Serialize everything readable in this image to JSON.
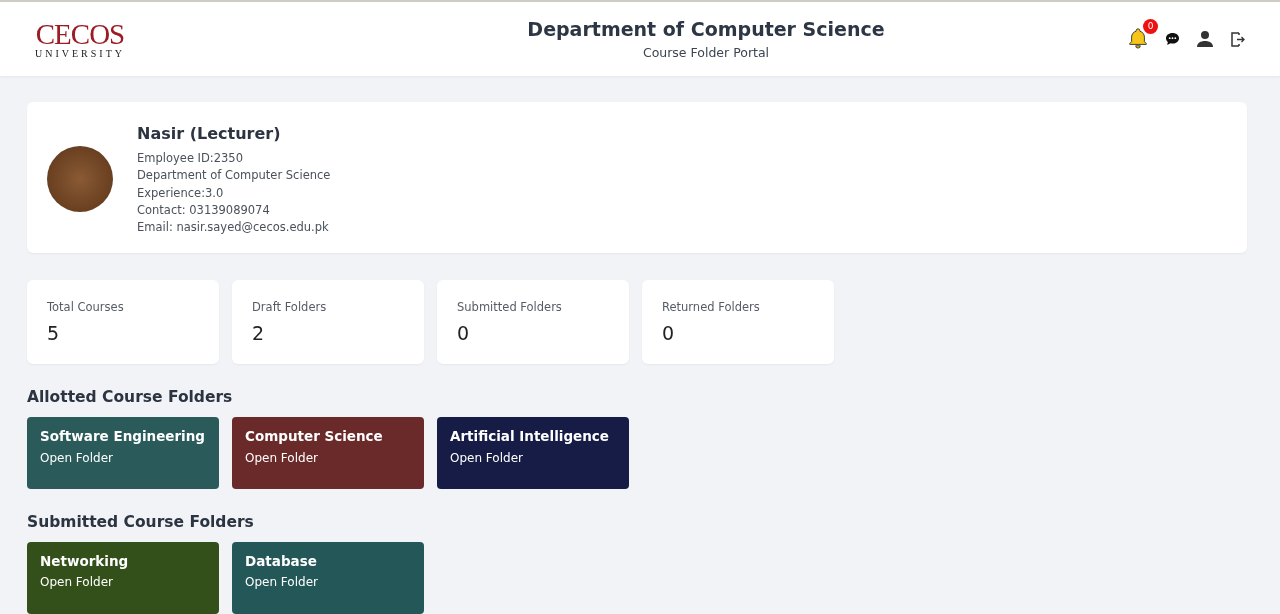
{
  "header": {
    "logo": {
      "name": "CECOS",
      "subtitle": "UNIVERSITY"
    },
    "title": "Department of Computer Science",
    "subtitle": "Course Folder Portal",
    "notifications": "0"
  },
  "profile": {
    "name": "Nasir (Lecturer)",
    "details": [
      "Employee ID:2350",
      "Department of Computer Science",
      "Experience:3.0",
      "Contact: 03139089074",
      "Email: nasir.sayed@cecos.edu.pk"
    ]
  },
  "stats": [
    {
      "label": "Total Courses",
      "value": "5"
    },
    {
      "label": "Draft Folders",
      "value": "2"
    },
    {
      "label": "Submitted Folders",
      "value": "0"
    },
    {
      "label": "Returned Folders",
      "value": "0"
    }
  ],
  "sections": [
    {
      "title": "Allotted Course Folders",
      "folders": [
        {
          "name": "Software Engineering",
          "link": "Open Folder",
          "color": "#2a5a5a"
        },
        {
          "name": "Computer Science",
          "link": "Open Folder",
          "color": "#6b2a2a"
        },
        {
          "name": "Artificial Intelligence",
          "link": "Open Folder",
          "color": "#171c46"
        }
      ]
    },
    {
      "title": "Submitted Course Folders",
      "folders": [
        {
          "name": "Networking",
          "link": "Open Folder",
          "color": "#34501a"
        },
        {
          "name": "Database",
          "link": "Open Folder",
          "color": "#245858"
        }
      ]
    }
  ]
}
